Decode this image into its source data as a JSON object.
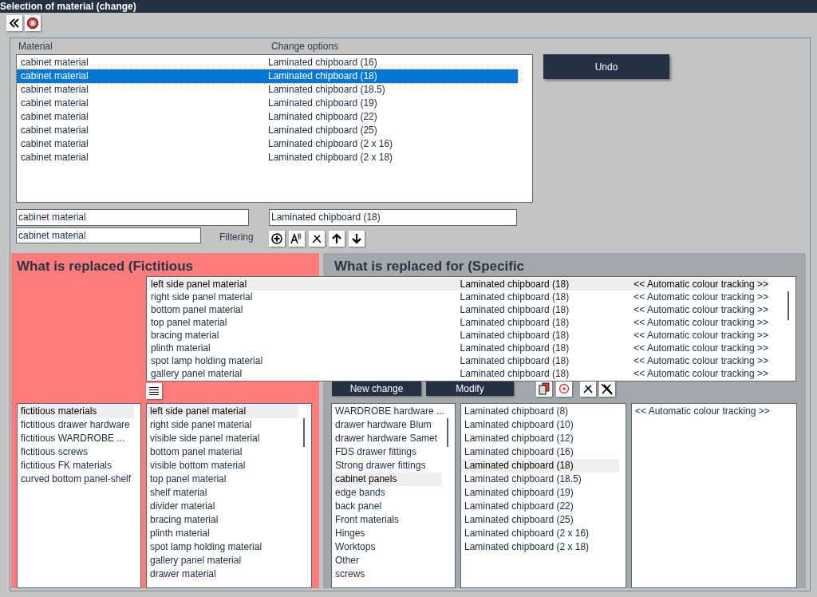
{
  "window": {
    "title": "Selection of material (change)"
  },
  "material_list": {
    "columns": [
      "Material",
      "Change options"
    ],
    "rows": [
      {
        "material": "cabinet material",
        "option": "Laminated chipboard (16)",
        "selected": false
      },
      {
        "material": "cabinet material",
        "option": "Laminated chipboard (18)",
        "selected": true
      },
      {
        "material": "cabinet material",
        "option": "Laminated chipboard (18.5)",
        "selected": false
      },
      {
        "material": "cabinet material",
        "option": "Laminated chipboard (19)",
        "selected": false
      },
      {
        "material": "cabinet material",
        "option": "Laminated chipboard (22)",
        "selected": false
      },
      {
        "material": "cabinet material",
        "option": "Laminated chipboard (25)",
        "selected": false
      },
      {
        "material": "cabinet material",
        "option": "Laminated chipboard (2 x 16)",
        "selected": false
      },
      {
        "material": "cabinet material",
        "option": "Laminated chipboard (2 x 18)",
        "selected": false
      }
    ]
  },
  "undo_button": "Undo",
  "material_field": {
    "value": "cabinet material"
  },
  "option_field": {
    "value": "Laminated chipboard (18)"
  },
  "filter_field": {
    "value": "cabinet material"
  },
  "filter_label": "Filtering",
  "replaced_panel": {
    "title": "What is replaced (Fictitious",
    "groups": [
      {
        "label": "fictitious materials",
        "selected": true
      },
      {
        "label": "fictitious drawer hardware",
        "selected": false
      },
      {
        "label": "fictitious WARDROBE ...",
        "selected": false
      },
      {
        "label": "fictitious screws",
        "selected": false
      },
      {
        "label": "fictitious FK materials",
        "selected": false
      },
      {
        "label": "curved bottom panel-shelf",
        "selected": false
      }
    ],
    "items": [
      {
        "label": "left side panel material",
        "selected": true
      },
      {
        "label": "right side panel material",
        "selected": false
      },
      {
        "label": "visible side panel material",
        "selected": false
      },
      {
        "label": "bottom panel material",
        "selected": false
      },
      {
        "label": "visible bottom material",
        "selected": false
      },
      {
        "label": "top panel material",
        "selected": false
      },
      {
        "label": "shelf material",
        "selected": false
      },
      {
        "label": "divider material",
        "selected": false
      },
      {
        "label": "bracing material",
        "selected": false
      },
      {
        "label": "plinth material",
        "selected": false
      },
      {
        "label": "spot lamp holding material",
        "selected": false
      },
      {
        "label": "gallery panel material",
        "selected": false
      },
      {
        "label": "drawer material",
        "selected": false
      }
    ]
  },
  "replacement_panel": {
    "title": "What is replaced for (Specific",
    "buttons": [
      "New change",
      "Modify"
    ],
    "categories": [
      {
        "label": "WARDROBE hardware ...",
        "selected": false
      },
      {
        "label": "drawer hardware Blum",
        "selected": false
      },
      {
        "label": "drawer hardware Samet",
        "selected": false
      },
      {
        "label": "FDS drawer fittings",
        "selected": false
      },
      {
        "label": "Strong drawer fittings",
        "selected": false
      },
      {
        "label": "cabinet panels",
        "selected": true
      },
      {
        "label": "edge bands",
        "selected": false
      },
      {
        "label": "back panel",
        "selected": false
      },
      {
        "label": "Front materials",
        "selected": false
      },
      {
        "label": "Hinges",
        "selected": false
      },
      {
        "label": "Worktops",
        "selected": false
      },
      {
        "label": "Other",
        "selected": false
      },
      {
        "label": "screws",
        "selected": false
      }
    ],
    "materials": [
      {
        "label": "Laminated chipboard (8)",
        "selected": false
      },
      {
        "label": "Laminated chipboard (10)",
        "selected": false
      },
      {
        "label": "Laminated chipboard (12)",
        "selected": false
      },
      {
        "label": "Laminated chipboard (16)",
        "selected": false
      },
      {
        "label": "Laminated chipboard (18)",
        "selected": true
      },
      {
        "label": "Laminated chipboard (18.5)",
        "selected": false
      },
      {
        "label": "Laminated chipboard (19)",
        "selected": false
      },
      {
        "label": "Laminated chipboard (22)",
        "selected": false
      },
      {
        "label": "Laminated chipboard (25)",
        "selected": false
      },
      {
        "label": "Laminated chipboard (2 x 16)",
        "selected": false
      },
      {
        "label": "Laminated chipboard (2 x 18)",
        "selected": false
      }
    ],
    "colours": [
      {
        "label": "<< Automatic colour tracking >>",
        "selected": false
      }
    ]
  },
  "assignments": [
    {
      "part": "left side panel material",
      "material": "Laminated chipboard (18)",
      "colour": "<< Automatic colour tracking >>",
      "selected": true
    },
    {
      "part": "right side panel material",
      "material": "Laminated chipboard (18)",
      "colour": "<< Automatic colour tracking >>",
      "selected": false
    },
    {
      "part": "bottom panel material",
      "material": "Laminated chipboard (18)",
      "colour": "<< Automatic colour tracking >>",
      "selected": false
    },
    {
      "part": "top panel material",
      "material": "Laminated chipboard (18)",
      "colour": "<< Automatic colour tracking >>",
      "selected": false
    },
    {
      "part": "bracing material",
      "material": "Laminated chipboard (18)",
      "colour": "<< Automatic colour tracking >>",
      "selected": false
    },
    {
      "part": "plinth material",
      "material": "Laminated chipboard (18)",
      "colour": "<< Automatic colour tracking >>",
      "selected": false
    },
    {
      "part": "spot lamp holding material",
      "material": "Laminated chipboard (18)",
      "colour": "<< Automatic colour tracking >>",
      "selected": false
    },
    {
      "part": "gallery panel material",
      "material": "Laminated chipboard (18)",
      "colour": "<< Automatic colour tracking >>",
      "selected": false
    }
  ]
}
